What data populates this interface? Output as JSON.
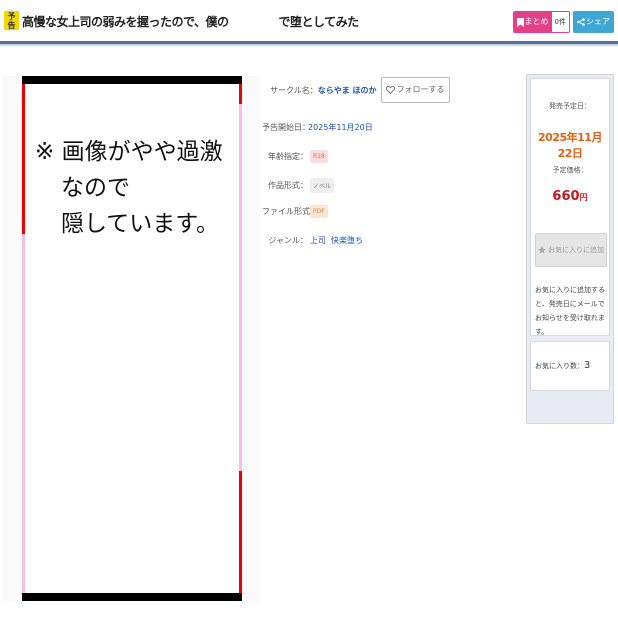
{
  "header": {
    "badge": "予告",
    "title_part1": "高慢な女上司の弱みを握ったので、僕の",
    "title_part2": "で堕としてみた",
    "matome_label": "まとめ",
    "matome_count": "0件",
    "share_label": "シェア"
  },
  "image": {
    "notice_line1": "※ 画像がやや過激なので",
    "notice_line2": "隠しています。"
  },
  "info": {
    "circle_label": "サークル名：",
    "circle_value": "ならやま ほのか",
    "follow_label": "フォローする",
    "release_label": "予告開始日：",
    "release_value": "2025年11月20日",
    "age_label": "年齢指定：",
    "age_value": "R18",
    "type_label": "作品形式：",
    "type_value": "ノベル",
    "file_label": "ファイル形式：",
    "file_value": "PDF",
    "genre_label": "ジャンル：",
    "genres": [
      "上司",
      "快楽堕ち"
    ]
  },
  "sidebar": {
    "release_date_label": "発売予定日：",
    "release_date": "2025年11月22日",
    "price_label": "予定価格：",
    "price": "660",
    "price_unit": "円",
    "fav_button": "お気に入りに追加",
    "fav_note": "お気に入りに追加すると、発売日にメールでお知らせを受け取れます。",
    "fav_count_label": "お気に入り数：",
    "fav_count": "3"
  },
  "colors": {
    "accent_blue": "#1d54a6",
    "date_orange": "#e0601a",
    "price_red": "#c4151d",
    "badge_yellow": "#f5d800",
    "matome_pink": "#e3408a",
    "share_blue": "#3fa6d4"
  }
}
